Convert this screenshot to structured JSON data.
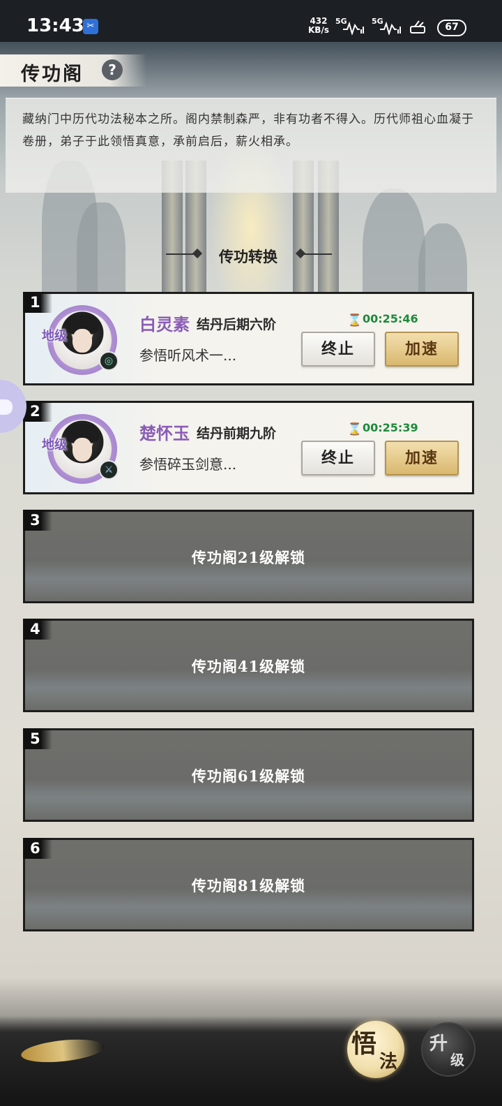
{
  "status_bar": {
    "time": "13:43",
    "speed_value": "432",
    "speed_unit": "KB/s",
    "net1": "5G",
    "net2": "5G",
    "battery": "67"
  },
  "header": {
    "title": "传功阁",
    "help_label": "?"
  },
  "description": "藏纳门中历代功法秘本之所。阁内禁制森严，非有功者不得入。历代师祖心血凝于卷册，弟子于此领悟真意，承前启后，薪火相承。",
  "section_title": "传功转换",
  "slots": [
    {
      "index": "1",
      "grade": "地级",
      "name": "白灵素",
      "rank": "结丹后期六阶",
      "task": "参悟听风术一...",
      "timer": "00:25:46",
      "stop_label": "终止",
      "speed_label": "加速"
    },
    {
      "index": "2",
      "grade": "地级",
      "name": "楚怀玉",
      "rank": "结丹前期九阶",
      "task": "参悟碎玉剑意...",
      "timer": "00:25:39",
      "stop_label": "终止",
      "speed_label": "加速"
    }
  ],
  "locked_slots": [
    {
      "index": "3",
      "text": "传功阁21级解锁"
    },
    {
      "index": "4",
      "text": "传功阁41级解锁"
    },
    {
      "index": "5",
      "text": "传功阁61级解锁"
    },
    {
      "index": "6",
      "text": "传功阁81级解锁"
    }
  ],
  "bottom": {
    "enlighten_1": "悟",
    "enlighten_2": "法",
    "upgrade_1": "升",
    "upgrade_2": "级"
  }
}
